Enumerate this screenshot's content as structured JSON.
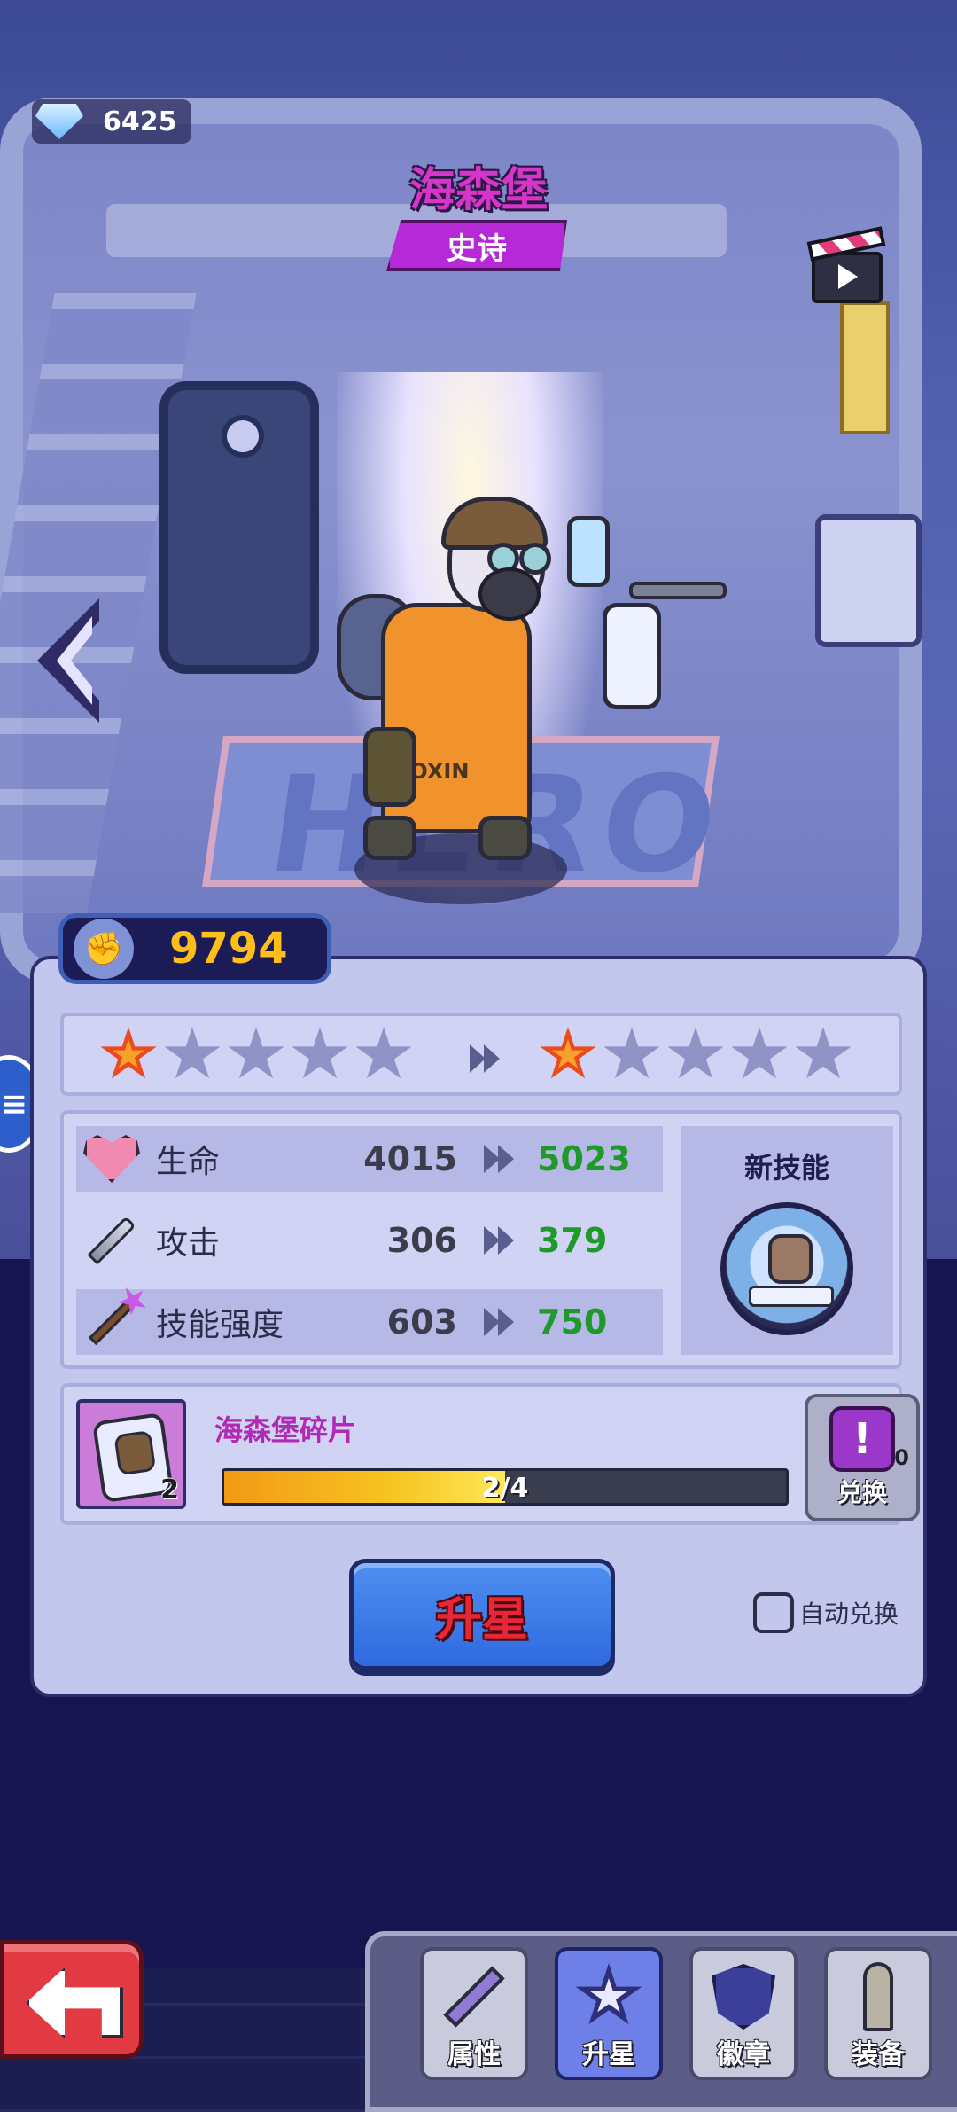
{
  "currency": {
    "gems": "6425",
    "icon": "diamond-icon"
  },
  "hero": {
    "name": "海森堡",
    "rarity": "史诗",
    "rarity_color": "#b52ad6",
    "shirt_text": "TOXIN",
    "rug_text": "HERO"
  },
  "power": {
    "value": "9794",
    "icon": "fist-icon"
  },
  "stars": {
    "current": 1,
    "next": 1,
    "total": 5
  },
  "stats": [
    {
      "icon": "heart-icon",
      "label": "生命",
      "current": "4015",
      "next": "5023"
    },
    {
      "icon": "sword-icon",
      "label": "攻击",
      "current": "306",
      "next": "379"
    },
    {
      "icon": "wand-icon",
      "label": "技能强度",
      "current": "603",
      "next": "750"
    }
  ],
  "new_skill": {
    "title": "新技能"
  },
  "shards": {
    "name": "海森堡碎片",
    "owned_count": "2",
    "progress_text": "2/4",
    "progress_fraction": 0.5,
    "exchange_label": "兑换",
    "exchange_count": "0"
  },
  "actions": {
    "star_up_label": "升星",
    "auto_exchange_label": "自动兑换",
    "auto_exchange_checked": false
  },
  "tabs": [
    {
      "label": "属性",
      "icon": "sword-tab-icon",
      "active": false
    },
    {
      "label": "升星",
      "icon": "star-tab-icon",
      "active": true
    },
    {
      "label": "徽章",
      "icon": "badge-tab-icon",
      "active": false
    },
    {
      "label": "装备",
      "icon": "bullet-tab-icon",
      "active": false
    }
  ],
  "colors": {
    "accent_next": "#1f9a2a",
    "power_value": "#ffbf1a",
    "star_button": "#2f6ae0",
    "star_label": "#e8263a"
  }
}
